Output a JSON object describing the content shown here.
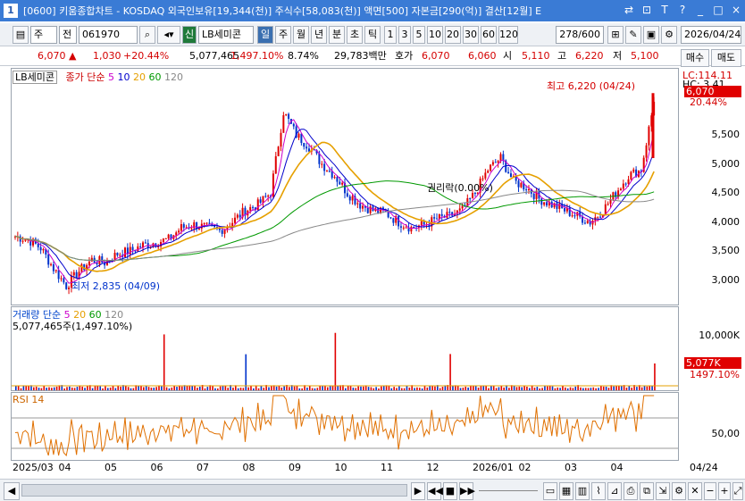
{
  "window": {
    "number": "1",
    "title": "[0600] 키움종합차트 - KOSDAQ 외국인보유[19,344(천)] 주식수[58,083(천)] 액면[500] 자본금[290(억)] 결산[12월] E",
    "controls": [
      "⇄",
      "⊡",
      "T",
      "?",
      "_",
      "□",
      "×"
    ]
  },
  "toolbar": {
    "type": "주",
    "prev": "전",
    "code": "061970",
    "market_badge": "신",
    "name": "LB세미콘",
    "periods": [
      "일",
      "주",
      "월",
      "년",
      "분",
      "초",
      "틱"
    ],
    "selected_period": "일",
    "numbers": [
      "1",
      "3",
      "5",
      "10",
      "20",
      "30",
      "60",
      "120"
    ],
    "count": "278/600",
    "date": "2026/04/24"
  },
  "quote": {
    "price": "6,070",
    "change": "1,030",
    "change_pct": "+20.44%",
    "volume": "5,077,465",
    "vol_pct": "1,497.10%",
    "turnover": "8.74%",
    "amount": "29,783백만",
    "ask_label": "호가",
    "ask": "6,070",
    "bid": "6,060",
    "open_label": "시",
    "open": "5,110",
    "high_label": "고",
    "high": "6,220",
    "low_label": "저",
    "low": "5,100",
    "buy_btn": "매수",
    "sell_btn": "매도"
  },
  "price_panel": {
    "name": "LB세미콘",
    "legend_title": "종가 단순",
    "ma": [
      "5",
      "10",
      "20",
      "60",
      "120"
    ],
    "ma_colors": [
      "#cc00cc",
      "#0000cc",
      "#e6a000",
      "#009900",
      "#888888"
    ],
    "lc": "LC:114.11",
    "hc": "HC: 3.41",
    "y_ticks": [
      "5,500",
      "5,000",
      "4,500",
      "4,000",
      "3,500",
      "3,000"
    ],
    "current_tag": "6,070",
    "pct_tag": "20.44%",
    "high_note": "최고 6,220 (04/24)",
    "low_note": "최저 2,835 (04/09)",
    "event": "권리락(0.00%)"
  },
  "volume_panel": {
    "legend": "거래량 단순",
    "ma": [
      "5",
      "20",
      "60",
      "120"
    ],
    "value": "5,077,465주(1,497.10%)",
    "y_tick": "10,000K",
    "tag": "5,077K",
    "tag_pct": "1497.10%"
  },
  "rsi_panel": {
    "legend": "RSI 14",
    "y_tick": "50,00"
  },
  "x_axis": [
    "2025/03",
    "04",
    "05",
    "06",
    "07",
    "08",
    "09",
    "10",
    "11",
    "12",
    "2026/01",
    "02",
    "03",
    "04"
  ],
  "x_end": "04/24",
  "chart_data": {
    "type": "candlestick",
    "x_start": "2025/03",
    "x_end": "2026/04/24",
    "ylim": [
      2700,
      6300
    ],
    "high": 6220,
    "low": 2835,
    "close": 6070,
    "closes": [
      3750,
      3700,
      3550,
      3200,
      2900,
      3150,
      3350,
      3300,
      3450,
      3500,
      3600,
      3650,
      3700,
      3900,
      3950,
      3900,
      3850,
      4000,
      4200,
      4300,
      4500,
      5900,
      5500,
      5300,
      5000,
      4800,
      4500,
      4300,
      4200,
      4150,
      4000,
      3900,
      3950,
      4050,
      4100,
      4200,
      4500,
      4900,
      5100,
      4700,
      4600,
      4400,
      4300,
      4200,
      4100,
      4000,
      4200,
      4500,
      4800,
      4900,
      6070
    ]
  }
}
